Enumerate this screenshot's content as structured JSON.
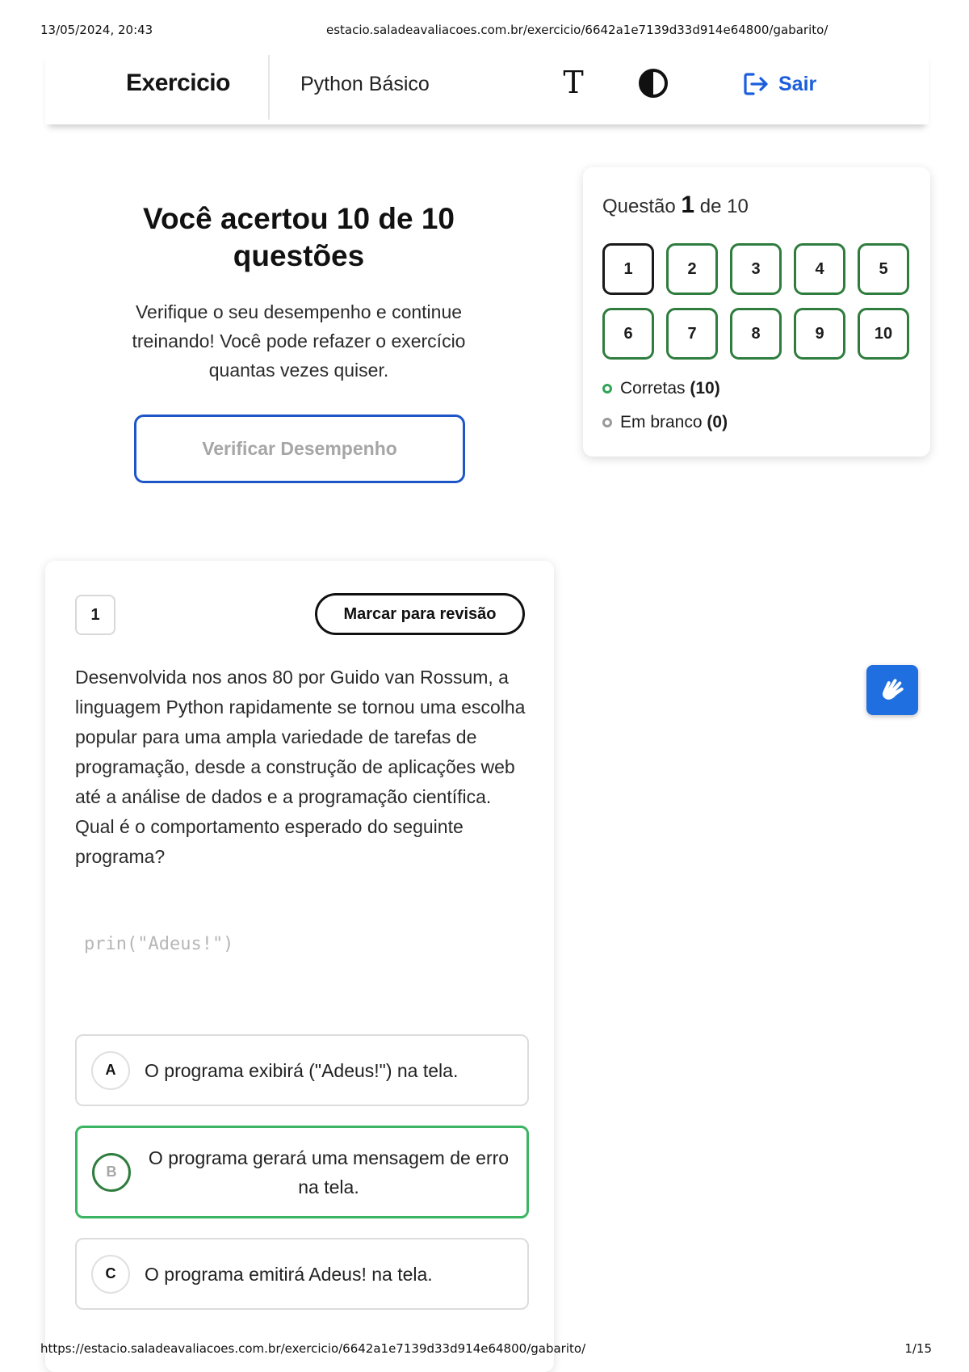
{
  "print_header": {
    "datetime": "13/05/2024, 20:43",
    "url": "estacio.saladeavaliacoes.com.br/exercicio/6642a1e7139d33d914e64800/gabarito/"
  },
  "print_footer": {
    "url": "https://estacio.saladeavaliacoes.com.br/exercicio/6642a1e7139d33d914e64800/gabarito/",
    "page": "1/15"
  },
  "header": {
    "brand": "Exercicio",
    "course": "Python Básico",
    "text_size_glyph": "T",
    "logout_label": "Sair",
    "accent_color": "#1b5fdc"
  },
  "result": {
    "title": "Você acertou 10 de 10 questões",
    "subtitle": "Verifique o seu desempenho e continue treinando! Você pode refazer o exercício quantas vezes quiser.",
    "verify_button": "Verificar Desempenho"
  },
  "navigator": {
    "heading_prefix": "Questão",
    "current": "1",
    "heading_suffix": "de 10",
    "questions": [
      "1",
      "2",
      "3",
      "4",
      "5",
      "6",
      "7",
      "8",
      "9",
      "10"
    ],
    "legend": {
      "correct_label": "Corretas",
      "correct_count": "(10)",
      "blank_label": "Em branco",
      "blank_count": "(0)"
    },
    "correct_color": "#2f7d3e"
  },
  "question": {
    "number": "1",
    "review_button": "Marcar para revisão",
    "text": "Desenvolvida nos anos 80 por Guido van Rossum, a linguagem Python rapidamente se tornou uma escolha popular para uma ampla variedade de tarefas de programação, desde a construção de aplicações web até a análise de dados e a programação científica. Qual é o comportamento esperado do seguinte programa?",
    "code": "prin(\"Adeus!\")",
    "options": [
      {
        "letter": "A",
        "text": "O programa exibirá (\"Adeus!\") na tela."
      },
      {
        "letter": "B",
        "text": "O programa gerará uma mensagem de erro na tela."
      },
      {
        "letter": "C",
        "text": "O programa emitirá Adeus! na tela."
      }
    ]
  }
}
